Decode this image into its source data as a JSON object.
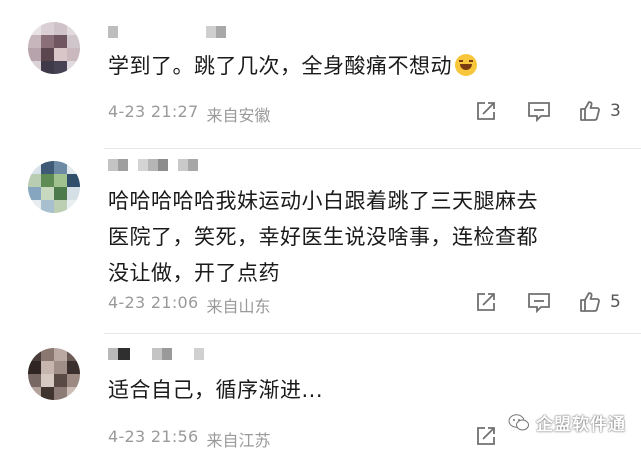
{
  "comments": [
    {
      "text": "学到了。跳了几次，全身酸痛不想动",
      "emoji": "laughing-tears-emoji",
      "date": "4-23 21:27",
      "location": "来自安徽",
      "likes": "3"
    },
    {
      "text": "哈哈哈哈哈我妹运动小白跟着跳了三天腿麻去医院了，笑死，幸好医生说没啥事，连检查都没让做，开了点药",
      "date": "4-23 21:06",
      "location": "来自山东",
      "likes": "5"
    },
    {
      "text": "适合自己，循序渐进...",
      "date": "4-23 21:56",
      "location": "来自江苏",
      "likes": ""
    }
  ],
  "watermark": {
    "text": "企盟软件通"
  },
  "icons": {
    "share": "share-icon",
    "reply": "comment-icon",
    "like": "thumbs-up-icon",
    "watermark": "wechat-icon"
  },
  "colors": {
    "text": "#1a1a1a",
    "meta": "#9a9a9a",
    "icon": "#707070",
    "divider": "#e6e6e6"
  }
}
